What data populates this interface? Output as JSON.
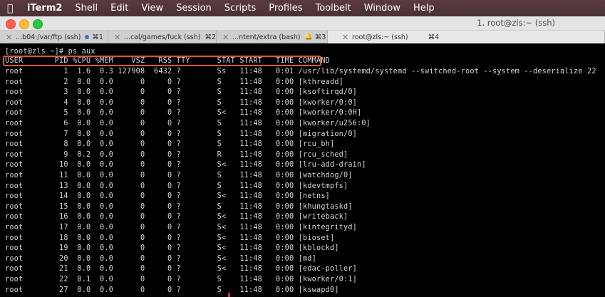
{
  "menubar": {
    "app": "iTerm2",
    "items": [
      "Shell",
      "Edit",
      "View",
      "Session",
      "Scripts",
      "Profiles",
      "Toolbelt",
      "Window",
      "Help"
    ]
  },
  "window": {
    "title": "1. root@zls:~ (ssh)"
  },
  "tabs": [
    {
      "label": "...b04:/var/ftp (ssh)",
      "shortcut": "⌘1",
      "indicator": "dot",
      "active": false
    },
    {
      "label": "...cal/games/fuck (ssh)",
      "shortcut": "⌘2",
      "indicator": "",
      "active": false
    },
    {
      "label": "...ntent/extra (bash)",
      "shortcut": "⌘3",
      "indicator": "bell",
      "active": false
    },
    {
      "label": "root@zls:~ (ssh)",
      "shortcut": "⌘4",
      "indicator": "",
      "active": true
    }
  ],
  "terminal": {
    "prompt": "[root@zls ~]# ps aux",
    "header": "USER       PID %CPU %MEM    VSZ   RSS TTY      STAT START   TIME COMMAND",
    "rows": [
      "root         1  1.6  0.3 127908  6432 ?        Ss   11:48   0:01 /usr/lib/systemd/systemd --switched-root --system --deserialize 22",
      "root         2  0.0  0.0      0     0 ?        S    11:48   0:00 [kthreadd]",
      "root         3  0.0  0.0      0     0 ?        S    11:48   0:00 [ksoftirqd/0]",
      "root         4  0.0  0.0      0     0 ?        S    11:48   0:00 [kworker/0:0]",
      "root         5  0.0  0.0      0     0 ?        S<   11:48   0:00 [kworker/0:0H]",
      "root         6  0.0  0.0      0     0 ?        S    11:48   0:00 [kworker/u256:0]",
      "root         7  0.0  0.0      0     0 ?        S    11:48   0:00 [migration/0]",
      "root         8  0.0  0.0      0     0 ?        S    11:48   0:00 [rcu_bh]",
      "root         9  0.2  0.0      0     0 ?        R    11:48   0:00 [rcu_sched]",
      "root        10  0.0  0.0      0     0 ?        S<   11:48   0:00 [lru-add-drain]",
      "root        11  0.0  0.0      0     0 ?        S    11:48   0:00 [watchdog/0]",
      "root        13  0.0  0.0      0     0 ?        S    11:48   0:00 [kdevtmpfs]",
      "root        14  0.0  0.0      0     0 ?        S<   11:48   0:00 [netns]",
      "root        15  0.0  0.0      0     0 ?        S    11:48   0:00 [khungtaskd]",
      "root        16  0.0  0.0      0     0 ?        S<   11:48   0:00 [writeback]",
      "root        17  0.0  0.0      0     0 ?        S<   11:48   0:00 [kintegrityd]",
      "root        18  0.0  0.0      0     0 ?        S<   11:48   0:00 [bioset]",
      "root        19  0.0  0.0      0     0 ?        S<   11:48   0:00 [kblockd]",
      "root        20  0.0  0.0      0     0 ?        S<   11:48   0:00 [md]",
      "root        21  0.0  0.0      0     0 ?        S<   11:48   0:00 [edac-poller]",
      "root        22  0.1  0.0      0     0 ?        S    11:48   0:00 [kworker/0:1]",
      "root        27  0.0  0.0      0     0 ?        S    11:48   0:00 [kswapd0]"
    ]
  },
  "colors": {
    "highlight": "#e0562b",
    "text": "#d6d6d6",
    "background": "#000000"
  }
}
